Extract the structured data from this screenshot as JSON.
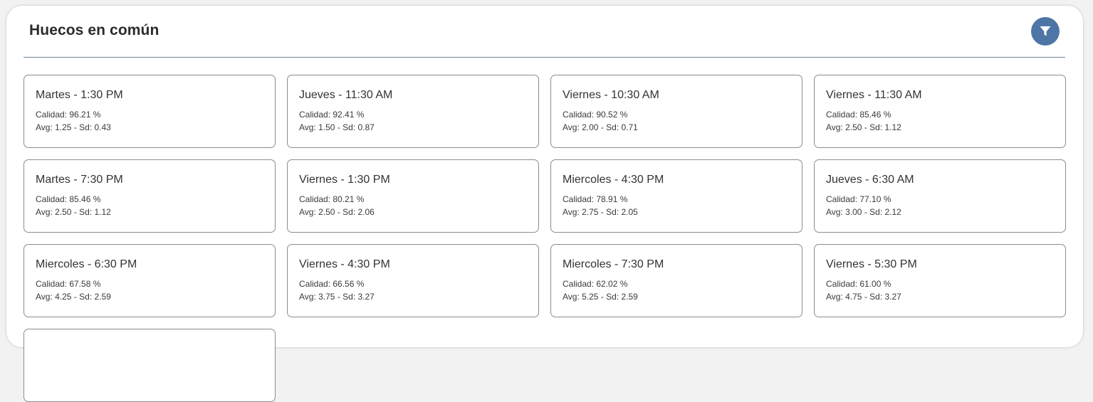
{
  "header": {
    "title": "Huecos en común",
    "accent_color": "#4d76a6",
    "filter_icon": "filter-icon"
  },
  "slots": [
    {
      "title": "Martes - 1:30 PM",
      "quality": "Calidad: 96.21 %",
      "stats": "Avg: 1.25 - Sd: 0.43"
    },
    {
      "title": "Jueves - 11:30 AM",
      "quality": "Calidad: 92.41 %",
      "stats": "Avg: 1.50 - Sd: 0.87"
    },
    {
      "title": "Viernes - 10:30 AM",
      "quality": "Calidad: 90.52 %",
      "stats": "Avg: 2.00 - Sd: 0.71"
    },
    {
      "title": "Viernes - 11:30 AM",
      "quality": "Calidad: 85.46 %",
      "stats": "Avg: 2.50 - Sd: 1.12"
    },
    {
      "title": "Martes - 7:30 PM",
      "quality": "Calidad: 85.46 %",
      "stats": "Avg: 2.50 - Sd: 1.12"
    },
    {
      "title": "Viernes - 1:30 PM",
      "quality": "Calidad: 80.21 %",
      "stats": "Avg: 2.50 - Sd: 2.06"
    },
    {
      "title": "Miercoles - 4:30 PM",
      "quality": "Calidad: 78.91 %",
      "stats": "Avg: 2.75 - Sd: 2.05"
    },
    {
      "title": "Jueves - 6:30 AM",
      "quality": "Calidad: 77.10 %",
      "stats": "Avg: 3.00 - Sd: 2.12"
    },
    {
      "title": "Miercoles - 6:30 PM",
      "quality": "Calidad: 67.58 %",
      "stats": "Avg: 4.25 - Sd: 2.59"
    },
    {
      "title": "Viernes - 4:30 PM",
      "quality": "Calidad: 66.56 %",
      "stats": "Avg: 3.75 - Sd: 3.27"
    },
    {
      "title": "Miercoles - 7:30 PM",
      "quality": "Calidad: 62.02 %",
      "stats": "Avg: 5.25 - Sd: 2.59"
    },
    {
      "title": "Viernes - 5:30 PM",
      "quality": "Calidad: 61.00 %",
      "stats": "Avg: 4.75 - Sd: 3.27"
    },
    {
      "title": "",
      "quality": "",
      "stats": ""
    }
  ]
}
